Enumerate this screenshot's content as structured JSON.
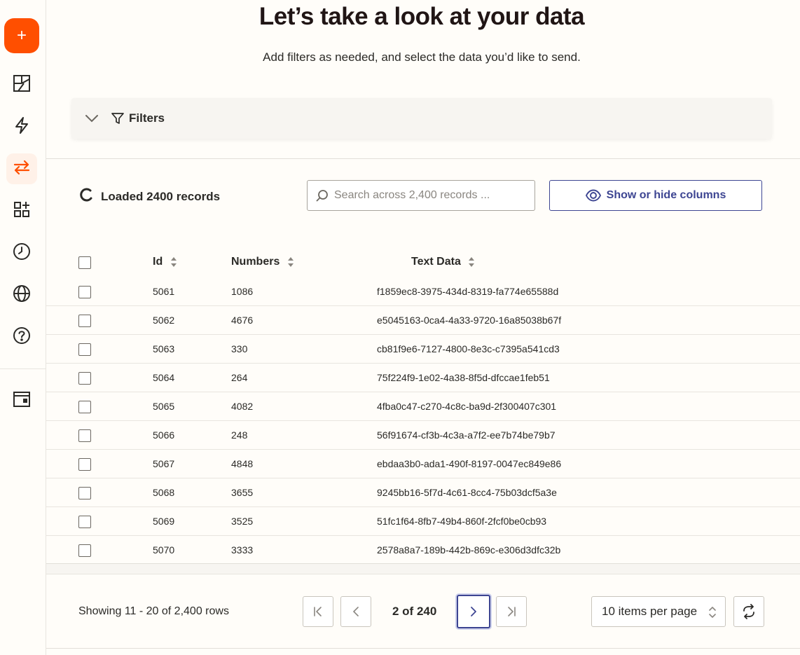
{
  "sidebar": {
    "create_label": "+",
    "items": [
      {
        "name": "sidebar-item-dashboard",
        "icon": "layout-icon"
      },
      {
        "name": "sidebar-item-zaps",
        "icon": "lightning-icon"
      },
      {
        "name": "sidebar-item-transfer",
        "icon": "transfer-icon",
        "active": true
      },
      {
        "name": "sidebar-item-apps",
        "icon": "apps-add-icon"
      },
      {
        "name": "sidebar-item-history",
        "icon": "clock-icon"
      },
      {
        "name": "sidebar-item-explore",
        "icon": "globe-icon"
      },
      {
        "name": "sidebar-item-help",
        "icon": "help-icon"
      },
      {
        "name": "sidebar-item-interfaces",
        "icon": "window-icon"
      }
    ]
  },
  "header": {
    "title": "Let’s take a look at your data",
    "subtitle": "Add filters as needed, and select the data you’d like to send."
  },
  "filters": {
    "label": "Filters"
  },
  "toolbar": {
    "loaded_text": "Loaded 2400 records",
    "search_placeholder": "Search across 2,400 records ...",
    "show_hide_label": "Show or hide columns"
  },
  "table": {
    "columns": [
      "Id",
      "Numbers",
      "Text Data"
    ],
    "rows": [
      [
        "5061",
        "1086",
        "f1859ec8-3975-434d-8319-fa774e65588d"
      ],
      [
        "5062",
        "4676",
        "e5045163-0ca4-4a33-9720-16a85038b67f"
      ],
      [
        "5063",
        "330",
        "cb81f9e6-7127-4800-8e3c-c7395a541cd3"
      ],
      [
        "5064",
        "264",
        "75f224f9-1e02-4a38-8f5d-dfccae1feb51"
      ],
      [
        "5065",
        "4082",
        "4fba0c47-c270-4c8c-ba9d-2f300407c301"
      ],
      [
        "5066",
        "248",
        "56f91674-cf3b-4c3a-a7f2-ee7b74be79b7"
      ],
      [
        "5067",
        "4848",
        "ebdaa3b0-ada1-490f-8197-0047ec849e86"
      ],
      [
        "5068",
        "3655",
        "9245bb16-5f7d-4c61-8cc4-75b03dcf5a3e"
      ],
      [
        "5069",
        "3525",
        "51fc1f64-8fb7-49b4-860f-2fcf0be0cb93"
      ],
      [
        "5070",
        "3333",
        "2578a8a7-189b-442b-869c-e306d3dfc32b"
      ]
    ]
  },
  "pagination": {
    "showing": "Showing 11 - 20 of 2,400 rows",
    "page_indicator": "2 of 240",
    "per_page": "10 items per page"
  },
  "colors": {
    "accent": "#ff4f00",
    "primary": "#3d4592",
    "background": "#fffdf9"
  }
}
